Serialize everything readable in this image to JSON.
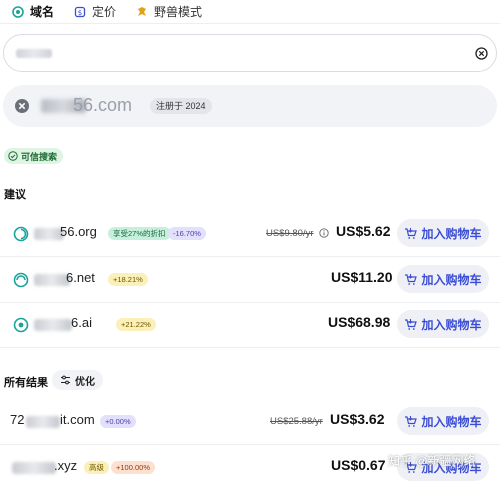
{
  "tabs": [
    {
      "label": "域名",
      "icon": "domain-icon",
      "active": true
    },
    {
      "label": "定价",
      "icon": "price-tag-icon",
      "active": false
    },
    {
      "label": "野兽模式",
      "icon": "beast-mode-icon",
      "active": false
    }
  ],
  "search": {
    "value": "",
    "clear_icon": "clear-icon"
  },
  "hero": {
    "domain": "72···56.com",
    "domain_visible": "56.com",
    "registered": "注册于 2024"
  },
  "trust_badge": "可信搜索",
  "suggestions": {
    "title": "建议",
    "rows": [
      {
        "tld": "56.org",
        "badges": [
          {
            "text": "享受27%的折扣",
            "style": "green"
          },
          {
            "text": "-16.70%",
            "style": "purple"
          }
        ],
        "old_price": "US$9.80/yr",
        "price": "US$5.62",
        "cart": "加入购物车"
      },
      {
        "tld": "6.net",
        "badges": [
          {
            "text": "+18.21%",
            "style": "yellow"
          }
        ],
        "old_price": "",
        "price": "US$11.20",
        "cart": "加入购物车"
      },
      {
        "tld": "6.ai",
        "badges": [
          {
            "text": "+21.22%",
            "style": "yellow"
          }
        ],
        "old_price": "",
        "price": "US$68.98",
        "cart": "加入购物车"
      }
    ]
  },
  "all_results": {
    "title": "所有结果",
    "optimize": "优化",
    "rows": [
      {
        "tld": "it.com",
        "prefix": "72",
        "badges": [
          {
            "text": "+0.00%",
            "style": "purple"
          }
        ],
        "old_price": "US$25.88/yr",
        "price": "US$3.62",
        "cart": "加入购物车"
      },
      {
        "tld": ".xyz",
        "badges": [
          {
            "text": "高级",
            "style": "yellow"
          },
          {
            "text": "+100.00%",
            "style": "orange"
          }
        ],
        "old_price": "",
        "price": "US$0.67",
        "cart": "加入购物车"
      }
    ]
  },
  "watermark": "知乎 @新疆网络",
  "colors": {
    "accent": "#3b4dd4",
    "teal": "#1aa39a",
    "trust_green": "#1d6b34"
  }
}
